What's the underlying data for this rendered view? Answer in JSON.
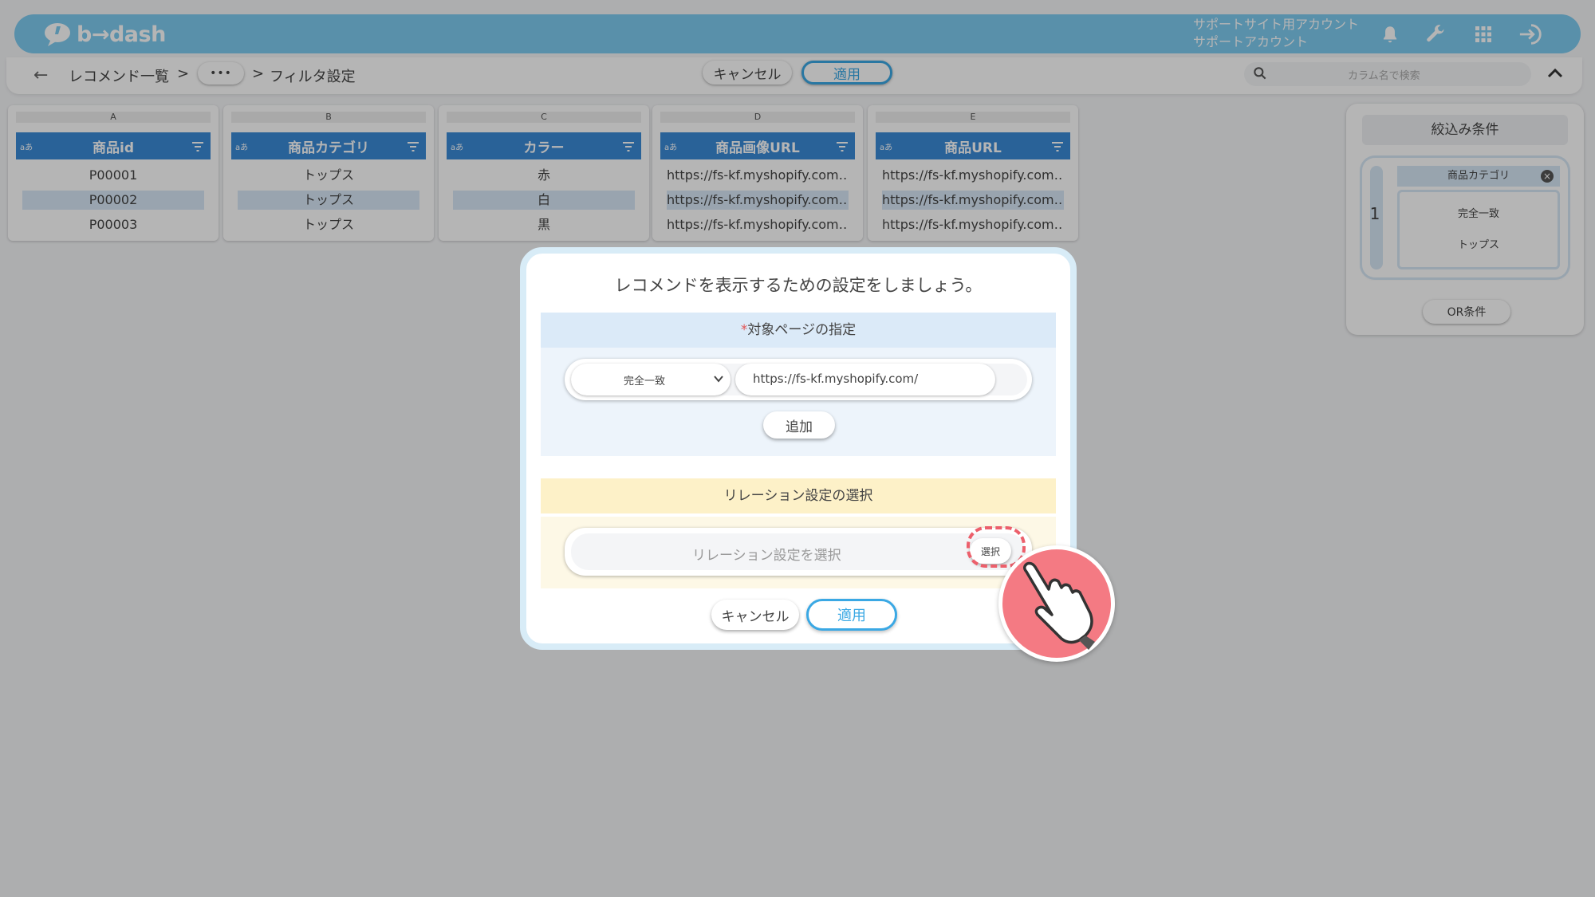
{
  "header": {
    "logo_text": "b→dash",
    "account_line1": "サポートサイト用アカウント",
    "account_line2": "サポートアカウント",
    "icons": [
      "bell-icon",
      "wrench-icon",
      "apps-grid-icon",
      "logout-icon"
    ]
  },
  "toolbar": {
    "back": "←",
    "crumb_1": "レコメンド一覧",
    "sep_1": ">",
    "more": "•••",
    "sep_2": ">",
    "crumb_2": "フィルタ設定",
    "cancel": "キャンセル",
    "apply": "適用",
    "search_placeholder": "カラム名で検索"
  },
  "columns": [
    {
      "letter": "A",
      "type": "aあ",
      "name": "商品id",
      "rows": [
        "P00001",
        "P00002",
        "P00003"
      ]
    },
    {
      "letter": "B",
      "type": "aあ",
      "name": "商品カテゴリ",
      "rows": [
        "トップス",
        "トップス",
        "トップス"
      ]
    },
    {
      "letter": "C",
      "type": "aあ",
      "name": "カラー",
      "rows": [
        "赤",
        "白",
        "黒"
      ]
    },
    {
      "letter": "D",
      "type": "aあ",
      "name": "商品画像URL",
      "rows": [
        "https://fs-kf.myshopify.com…",
        "https://fs-kf.myshopify.com…",
        "https://fs-kf.myshopify.com…"
      ]
    },
    {
      "letter": "E",
      "type": "aあ",
      "name": "商品URL",
      "rows": [
        "https://fs-kf.myshopify.com…",
        "https://fs-kf.myshopify.com…",
        "https://fs-kf.myshopify.com…"
      ]
    }
  ],
  "filter_panel": {
    "title": "絞込み条件",
    "group_number": "1",
    "condition_column": "商品カテゴリ",
    "condition_remove": "×",
    "condition_operator": "完全一致",
    "condition_value": "トップス",
    "or_button": "OR条件"
  },
  "modal": {
    "title": "レコメンドを表示するための設定をしましょう。",
    "target_section": {
      "required_mark": "*",
      "heading": "対象ページの指定",
      "match_type": "完全一致",
      "url_value": "https://fs-kf.myshopify.com/",
      "add_button": "追加"
    },
    "relation_section": {
      "heading": "リレーション設定の選択",
      "placeholder": "リレーション設定を選択",
      "select_button": "選択"
    },
    "cancel_button": "キャンセル",
    "apply_button": "適用"
  },
  "colors": {
    "header_bg": "#7ecbf0",
    "column_header": "#3a8ad6",
    "accent": "#3aa8e4",
    "highlight": "#f47a83"
  }
}
